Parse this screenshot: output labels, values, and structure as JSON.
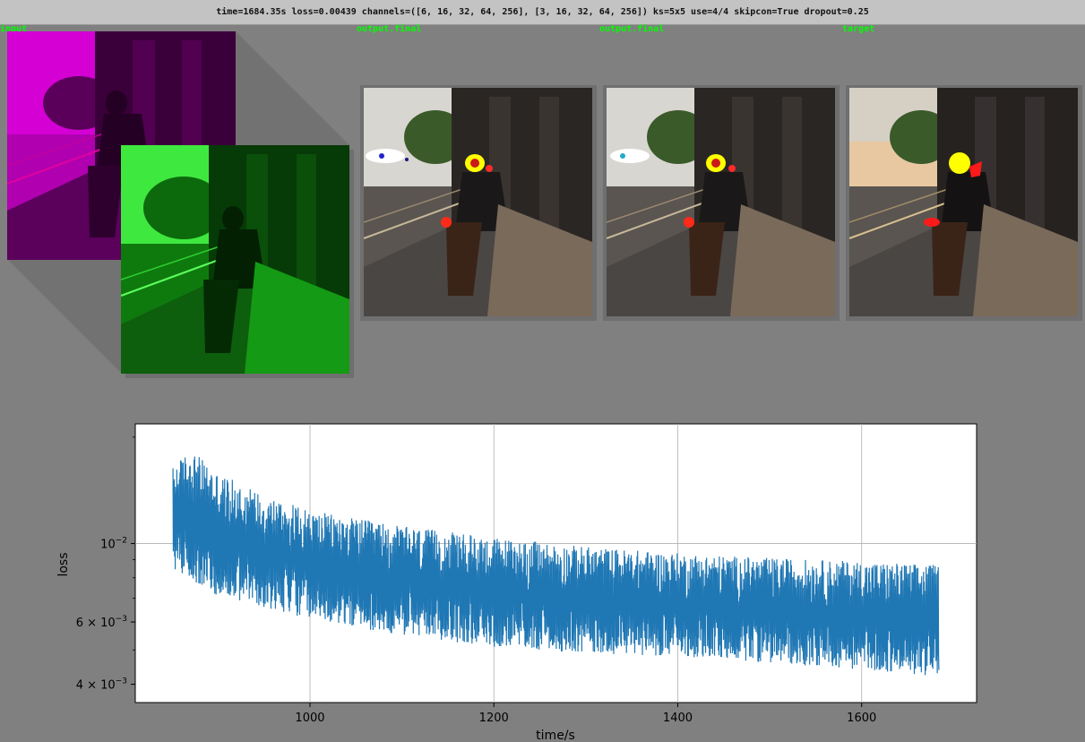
{
  "header": {
    "status_text": "time=1684.35s loss=0.00439  channels=([6, 16, 32, 64, 256], [3, 16, 32, 64, 256]) ks=5x5 use=4/4 skipcon=True dropout=0.25"
  },
  "panels": {
    "input_label": "input",
    "output_label_1": "output.final",
    "output_label_2": "output.final",
    "target_label": "target"
  },
  "colors": {
    "background": "#808080",
    "label_green": "#00ff00",
    "series_blue": "#1f77b4",
    "input_magenta": "#d100d1",
    "input_green": "#22d322",
    "mask_yellow": "#ffff00",
    "mask_red": "#ff1a1a"
  },
  "chart_data": {
    "type": "line",
    "xlabel": "time/s",
    "ylabel": "loss",
    "yscale": "log",
    "grid": true,
    "xlim": [
      810,
      1725
    ],
    "ylim": [
      0.00355,
      0.0218
    ],
    "xticks": [
      1000,
      1200,
      1400,
      1600
    ],
    "xtick_labels": [
      "1000",
      "1200",
      "1400",
      "1600"
    ],
    "yticks": [
      0.01,
      0.006,
      0.004
    ],
    "ytick_labels": [
      "10",
      "6 × 10",
      "4 × 10"
    ],
    "ytick_exponent": "−2",
    "ytick_exponent_2": "−3",
    "series": [
      {
        "x_start": 851,
        "x_end": 1684,
        "upper_envelope": [
          [
            851,
            0.0165
          ],
          [
            870,
            0.0185
          ],
          [
            900,
            0.0158
          ],
          [
            950,
            0.0138
          ],
          [
            1000,
            0.0124
          ],
          [
            1100,
            0.0112
          ],
          [
            1200,
            0.0104
          ],
          [
            1300,
            0.0098
          ],
          [
            1400,
            0.0094
          ],
          [
            1500,
            0.0091
          ],
          [
            1600,
            0.0089
          ],
          [
            1684,
            0.0087
          ]
        ],
        "lower_envelope": [
          [
            851,
            0.0085
          ],
          [
            870,
            0.0079
          ],
          [
            900,
            0.0071
          ],
          [
            950,
            0.0066
          ],
          [
            1000,
            0.0061
          ],
          [
            1100,
            0.0055
          ],
          [
            1200,
            0.0051
          ],
          [
            1300,
            0.0049
          ],
          [
            1400,
            0.0048
          ],
          [
            1500,
            0.0046
          ],
          [
            1600,
            0.0044
          ],
          [
            1684,
            0.0042
          ]
        ],
        "final_value": 0.00439
      }
    ]
  }
}
